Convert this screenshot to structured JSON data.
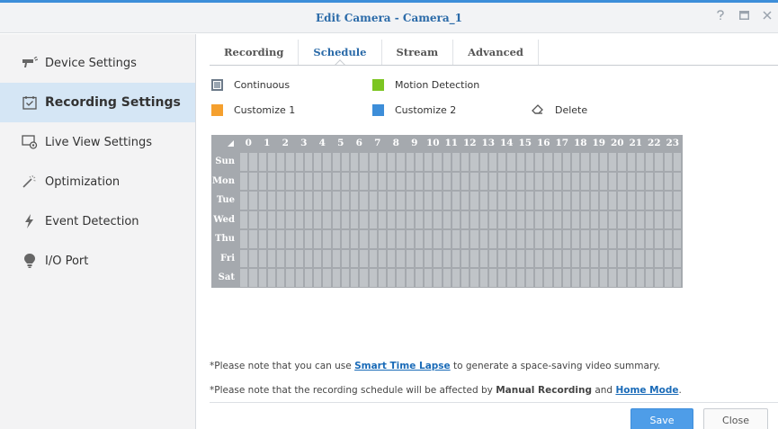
{
  "window": {
    "title": "Edit Camera - Camera_1",
    "help_icon": "help-icon",
    "maximize_icon": "maximize-icon",
    "close_icon": "close-icon"
  },
  "sidebar": {
    "items": [
      {
        "label": "Device Settings",
        "icon": "camera-icon",
        "active": false
      },
      {
        "label": "Recording Settings",
        "icon": "calendar-check-icon",
        "active": true
      },
      {
        "label": "Live View Settings",
        "icon": "monitor-settings-icon",
        "active": false
      },
      {
        "label": "Optimization",
        "icon": "magic-wand-icon",
        "active": false
      },
      {
        "label": "Event Detection",
        "icon": "lightning-icon",
        "active": false
      },
      {
        "label": "I/O Port",
        "icon": "lightbulb-icon",
        "active": false
      }
    ]
  },
  "tabs": [
    {
      "label": "Recording",
      "active": false
    },
    {
      "label": "Schedule",
      "active": true
    },
    {
      "label": "Stream",
      "active": false
    },
    {
      "label": "Advanced",
      "active": false
    }
  ],
  "legend": {
    "continuous": "Continuous",
    "motion": "Motion Detection",
    "customize1": "Customize 1",
    "customize2": "Customize 2",
    "delete": "Delete",
    "colors": {
      "continuous": "#9aa6b2",
      "motion": "#7cc522",
      "customize1": "#f5a02e",
      "customize2": "#3d8ed9"
    }
  },
  "schedule": {
    "hours": [
      "0",
      "1",
      "2",
      "3",
      "4",
      "5",
      "6",
      "7",
      "8",
      "9",
      "10",
      "11",
      "12",
      "13",
      "14",
      "15",
      "16",
      "17",
      "18",
      "19",
      "20",
      "21",
      "22",
      "23"
    ],
    "days": [
      "Sun",
      "Mon",
      "Tue",
      "Wed",
      "Thu",
      "Fri",
      "Sat"
    ]
  },
  "notes": {
    "line1_prefix": "*Please note that you can use ",
    "line1_link": "Smart Time Lapse",
    "line1_suffix": " to generate a space-saving video summary.",
    "line2_prefix": "*Please note that the recording schedule will be affected by ",
    "line2_bold": "Manual Recording",
    "line2_mid": " and ",
    "line2_link": "Home Mode",
    "line2_suffix": "."
  },
  "buttons": {
    "save": "Save",
    "close": "Close"
  },
  "accent": "#3d8ed9"
}
